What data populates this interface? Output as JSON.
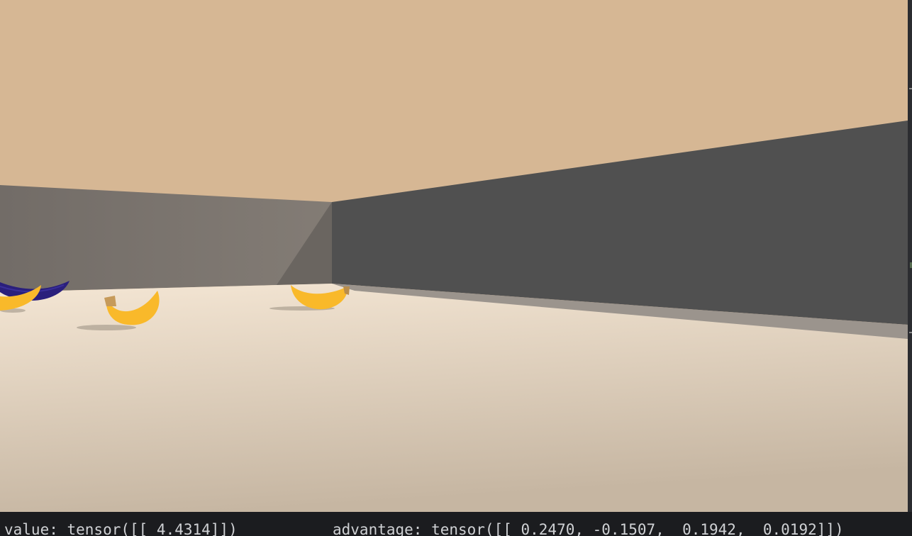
{
  "scene": {
    "colors": {
      "sky": "#d6b794",
      "wall_left": "#7c756f",
      "wall_right": "#505050",
      "floor_near": "#c8b9a6",
      "floor_far": "#f3e4d2",
      "banana_yellow": "#f9b92a",
      "banana_blue": "#2a1f7c"
    },
    "objects": [
      "blue-banana-icon",
      "yellow-banana-icon",
      "yellow-banana-icon",
      "yellow-banana-icon"
    ]
  },
  "terminal": {
    "value_line": "value: tensor([[ 4.4314]])",
    "advantage_line": "advantage: tensor([[ 0.2470, -0.1507,  0.1942,  0.0192]])"
  }
}
